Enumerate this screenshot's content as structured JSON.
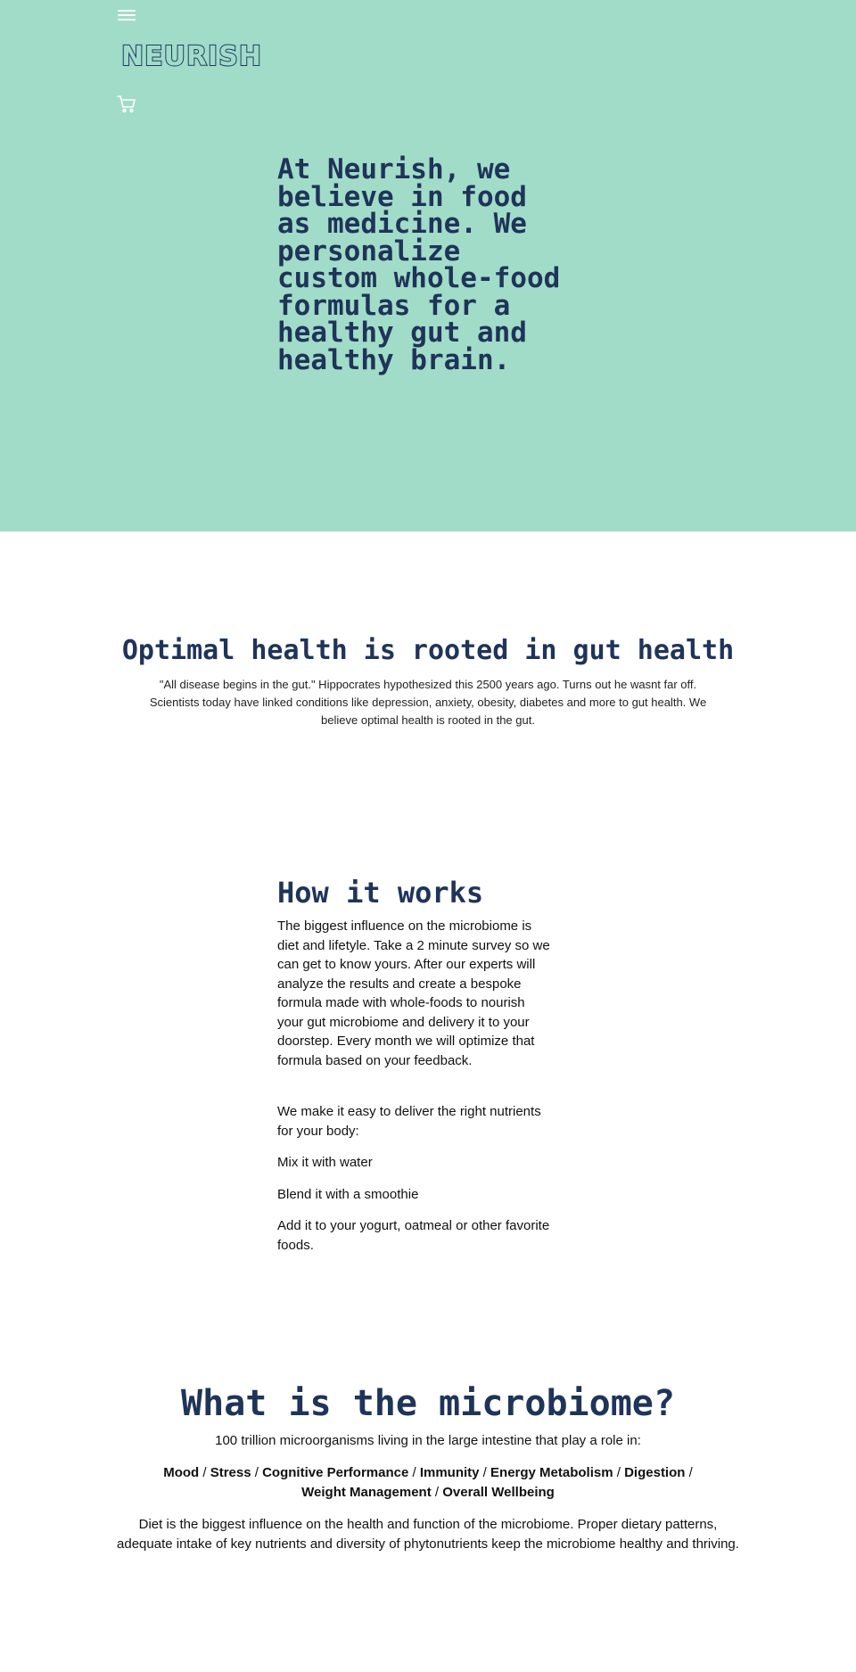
{
  "header": {
    "menu_icon": "hamburger-menu-icon",
    "logo_text": "NEURISH",
    "cart_icon": "shopping-cart-icon",
    "colors": {
      "hero_bg": "#a1dcc8",
      "brand_navy": "#1f3459",
      "icon_white": "#ffffff"
    }
  },
  "hero": {
    "headline": "At Neurish, we believe in food as medicine. We personalize custom whole-food formulas for a healthy gut and healthy brain."
  },
  "gut_section": {
    "title": "Optimal health is rooted in gut health",
    "body": "\"All disease begins in the gut.\" Hippocrates hypothesized this 2500 years ago. Turns out he wasnt far off. Scientists today have linked conditions like depression, anxiety, obesity, diabetes and more to gut health. We believe optimal health is rooted in the gut."
  },
  "how_section": {
    "title": "How it works",
    "body": "The biggest influence on the microbiome is diet and lifetyle. Take a 2 minute survey so we can get to know yours. After our experts will analyze the results and create a bespoke formula made with whole-foods to nourish your gut microbiome and delivery it to your doorstep. Every month we will optimize that formula based on your feedback.",
    "intro": "We make it easy to deliver the right nutrients for your body:",
    "options": [
      "Mix it with water",
      "Blend it with a smoothie",
      "Add it to your yogurt, oatmeal or other favorite foods."
    ]
  },
  "microbiome_section": {
    "title": "What is the microbiome?",
    "intro": "100 trillion microorganisms living in the large intestine that play a role in:",
    "roles": [
      "Mood",
      "Stress",
      "Cognitive Performance",
      "Immunity",
      "Energy Metabolism",
      "Digestion",
      "Weight Management",
      "Overall Wellbeing"
    ],
    "separator": " / ",
    "diet": "Diet is the biggest influence on the health and function of the microbiome. Proper dietary patterns, adequate intake of key nutrients and diversity of phytonutrients keep the microbiome healthy and thriving."
  }
}
